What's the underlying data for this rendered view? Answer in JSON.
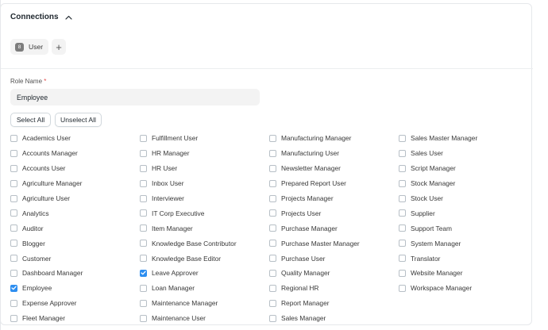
{
  "connections": {
    "title": "Connections",
    "chip": {
      "count": "8",
      "label": "User"
    },
    "add_label": "+"
  },
  "role": {
    "label": "Role Name",
    "required_mark": "*",
    "value": "Employee"
  },
  "actions": {
    "select_all": "Select All",
    "unselect_all": "Unselect All"
  },
  "colors": {
    "accent": "#2d8ef0",
    "required": "#e24c4c"
  },
  "columns": [
    [
      {
        "label": "Academics User",
        "checked": false
      },
      {
        "label": "Accounts Manager",
        "checked": false
      },
      {
        "label": "Accounts User",
        "checked": false
      },
      {
        "label": "Agriculture Manager",
        "checked": false
      },
      {
        "label": "Agriculture User",
        "checked": false
      },
      {
        "label": "Analytics",
        "checked": false
      },
      {
        "label": "Auditor",
        "checked": false
      },
      {
        "label": "Blogger",
        "checked": false
      },
      {
        "label": "Customer",
        "checked": false
      },
      {
        "label": "Dashboard Manager",
        "checked": false
      },
      {
        "label": "Employee",
        "checked": true
      },
      {
        "label": "Expense Approver",
        "checked": false
      },
      {
        "label": "Fleet Manager",
        "checked": false
      }
    ],
    [
      {
        "label": "Fulfillment User",
        "checked": false
      },
      {
        "label": "HR Manager",
        "checked": false
      },
      {
        "label": "HR User",
        "checked": false
      },
      {
        "label": "Inbox User",
        "checked": false
      },
      {
        "label": "Interviewer",
        "checked": false
      },
      {
        "label": "IT Corp Executive",
        "checked": false
      },
      {
        "label": "Item Manager",
        "checked": false
      },
      {
        "label": "Knowledge Base Contributor",
        "checked": false
      },
      {
        "label": "Knowledge Base Editor",
        "checked": false
      },
      {
        "label": "Leave Approver",
        "checked": true
      },
      {
        "label": "Loan Manager",
        "checked": false
      },
      {
        "label": "Maintenance Manager",
        "checked": false
      },
      {
        "label": "Maintenance User",
        "checked": false
      }
    ],
    [
      {
        "label": "Manufacturing Manager",
        "checked": false
      },
      {
        "label": "Manufacturing User",
        "checked": false
      },
      {
        "label": "Newsletter Manager",
        "checked": false
      },
      {
        "label": "Prepared Report User",
        "checked": false
      },
      {
        "label": "Projects Manager",
        "checked": false
      },
      {
        "label": "Projects User",
        "checked": false
      },
      {
        "label": "Purchase Manager",
        "checked": false
      },
      {
        "label": "Purchase Master Manager",
        "checked": false
      },
      {
        "label": "Purchase User",
        "checked": false
      },
      {
        "label": "Quality Manager",
        "checked": false
      },
      {
        "label": "Regional HR",
        "checked": false
      },
      {
        "label": "Report Manager",
        "checked": false
      },
      {
        "label": "Sales Manager",
        "checked": false
      }
    ],
    [
      {
        "label": "Sales Master Manager",
        "checked": false
      },
      {
        "label": "Sales User",
        "checked": false
      },
      {
        "label": "Script Manager",
        "checked": false
      },
      {
        "label": "Stock Manager",
        "checked": false
      },
      {
        "label": "Stock User",
        "checked": false
      },
      {
        "label": "Supplier",
        "checked": false
      },
      {
        "label": "Support Team",
        "checked": false
      },
      {
        "label": "System Manager",
        "checked": false
      },
      {
        "label": "Translator",
        "checked": false
      },
      {
        "label": "Website Manager",
        "checked": false
      },
      {
        "label": "Workspace Manager",
        "checked": false
      }
    ]
  ]
}
